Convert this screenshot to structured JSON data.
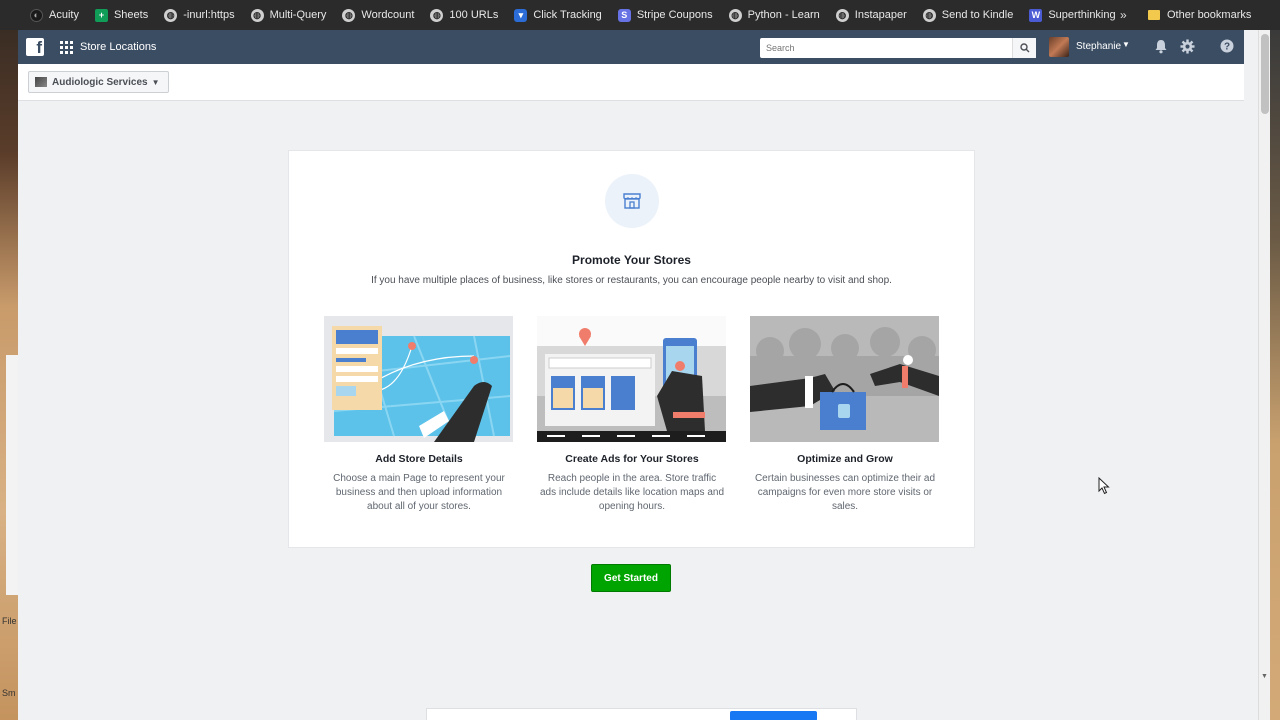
{
  "bookmarks": [
    {
      "label": "Acuity",
      "icon": "acuity-icon"
    },
    {
      "label": "Sheets",
      "icon": "sheets-icon"
    },
    {
      "label": "-inurl:https",
      "icon": "globe-icon"
    },
    {
      "label": "Multi-Query",
      "icon": "globe-icon"
    },
    {
      "label": "Wordcount",
      "icon": "globe-icon"
    },
    {
      "label": "100 URLs",
      "icon": "globe-icon"
    },
    {
      "label": "Click Tracking",
      "icon": "shield-icon"
    },
    {
      "label": "Stripe Coupons",
      "icon": "stripe-icon"
    },
    {
      "label": "Python - Learn",
      "icon": "globe-icon"
    },
    {
      "label": "Instapaper",
      "icon": "globe-icon"
    },
    {
      "label": "Send to Kindle",
      "icon": "globe-icon"
    },
    {
      "label": "Superthinking",
      "icon": "w-icon"
    }
  ],
  "bookmarks_more": "»",
  "other_bookmarks": "Other bookmarks",
  "nav": {
    "title": "Store Locations",
    "search_placeholder": "Search",
    "user_name": "Stephanie",
    "brand_color": "#3b4d63"
  },
  "page_selector": {
    "label": "Audiologic Services"
  },
  "promo": {
    "title": "Promote Your Stores",
    "subtitle": "If you have multiple places of business, like stores or restaurants, you can encourage people nearby to visit and shop.",
    "features": [
      {
        "title": "Add Store Details",
        "desc": "Choose a main Page to represent your business and then upload information about all of your stores."
      },
      {
        "title": "Create Ads for Your Stores",
        "desc": "Reach people in the area. Store traffic ads include details like location maps and opening hours."
      },
      {
        "title": "Optimize and Grow",
        "desc": "Certain businesses can optimize their ad campaigns for even more store visits or sales."
      }
    ]
  },
  "cta": {
    "label": "Get Started",
    "color": "#00a400"
  },
  "desktop_labels": [
    "File",
    "Sm"
  ]
}
